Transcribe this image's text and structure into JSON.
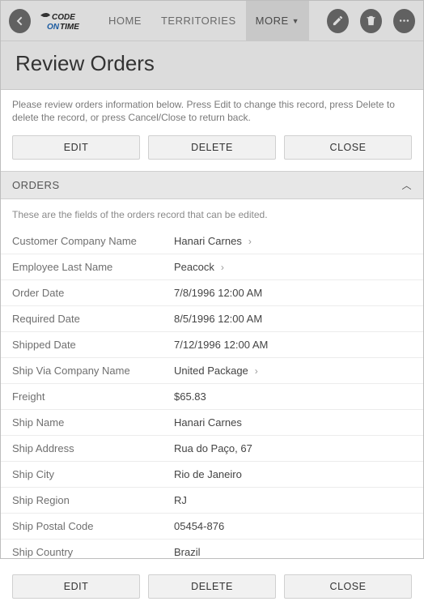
{
  "nav": {
    "home": "HOME",
    "territories": "TERRITORIES",
    "more": "MORE"
  },
  "title": "Review Orders",
  "instruction": "Please review orders information below. Press Edit to change this record, press Delete to delete the record, or press Cancel/Close to return back.",
  "buttons": {
    "edit": "EDIT",
    "delete": "DELETE",
    "close": "CLOSE"
  },
  "section": {
    "header": "ORDERS",
    "description": "These are the fields of the orders record that can be edited."
  },
  "fields": [
    {
      "label": "Customer Company Name",
      "value": "Hanari Carnes",
      "link": true
    },
    {
      "label": "Employee Last Name",
      "value": "Peacock",
      "link": true
    },
    {
      "label": "Order Date",
      "value": "7/8/1996 12:00 AM",
      "link": false
    },
    {
      "label": "Required Date",
      "value": "8/5/1996 12:00 AM",
      "link": false
    },
    {
      "label": "Shipped Date",
      "value": "7/12/1996 12:00 AM",
      "link": false
    },
    {
      "label": "Ship Via Company Name",
      "value": "United Package",
      "link": true
    },
    {
      "label": "Freight",
      "value": "$65.83",
      "link": false
    },
    {
      "label": "Ship Name",
      "value": "Hanari Carnes",
      "link": false
    },
    {
      "label": "Ship Address",
      "value": "Rua do Paço, 67",
      "link": false
    },
    {
      "label": "Ship City",
      "value": "Rio de Janeiro",
      "link": false
    },
    {
      "label": "Ship Region",
      "value": "RJ",
      "link": false
    },
    {
      "label": "Ship Postal Code",
      "value": "05454-876",
      "link": false
    },
    {
      "label": "Ship Country",
      "value": "Brazil",
      "link": false
    }
  ]
}
